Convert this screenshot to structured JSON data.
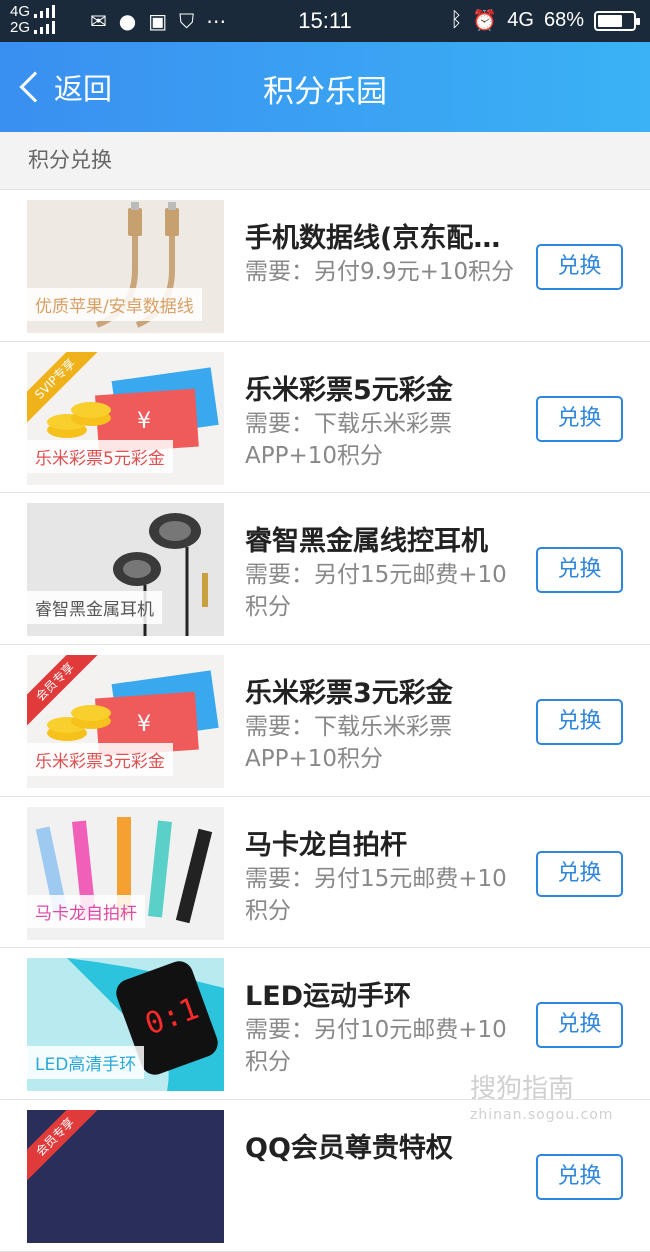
{
  "status_bar": {
    "signal_top": "4G",
    "signal_bottom": "2G",
    "time": "15:11",
    "network": "4G",
    "battery": "68%",
    "app_icons": [
      "wechat-icon",
      "message-icon",
      "sim-icon",
      "shield-icon",
      "more-icon"
    ],
    "right_icons": [
      "bluetooth-icon",
      "alarm-icon"
    ]
  },
  "header": {
    "back_label": "返回",
    "title": "积分乐园",
    "gradient_start": "#3a8ff0",
    "gradient_end": "#3ab2f5"
  },
  "section_title": "积分兑换",
  "items": [
    {
      "name": "手机数据线(京东配…",
      "need": "需要：另付9.9元+10积分",
      "caption": "优质苹果/安卓数据线",
      "button": "兑换",
      "caption_color": "#d9a064"
    },
    {
      "name": "乐米彩票5元彩金",
      "need": "需要：下载乐米彩票APP+10积分",
      "caption": "乐米彩票5元彩金",
      "button": "兑换",
      "ribbon": "SVIP专享",
      "caption_color": "#e05050"
    },
    {
      "name": "睿智黑金属线控耳机",
      "need": "需要：另付15元邮费+10积分",
      "caption": "睿智黑金属耳机",
      "button": "兑换",
      "caption_color": "#555555"
    },
    {
      "name": "乐米彩票3元彩金",
      "need": "需要：下载乐米彩票APP+10积分",
      "caption": "乐米彩票3元彩金",
      "button": "兑换",
      "ribbon": "会员专享",
      "caption_color": "#e05050"
    },
    {
      "name": "马卡龙自拍杆",
      "need": "需要：另付15元邮费+10积分",
      "caption": "马卡龙自拍杆",
      "button": "兑换",
      "caption_color": "#e04aa8"
    },
    {
      "name": "LED运动手环",
      "need": "需要：另付10元邮费+10积分",
      "caption": "LED高清手环",
      "button": "兑换",
      "caption_color": "#2aa8d8"
    },
    {
      "name": "QQ会员尊贵特权",
      "need": "",
      "caption": "",
      "button": "兑换",
      "ribbon": "会员专享",
      "caption_color": "#e05050"
    }
  ],
  "watermark": {
    "main": "搜狗指南",
    "sub": "zhinan.sogou.com"
  },
  "accent_color": "#2f86de"
}
